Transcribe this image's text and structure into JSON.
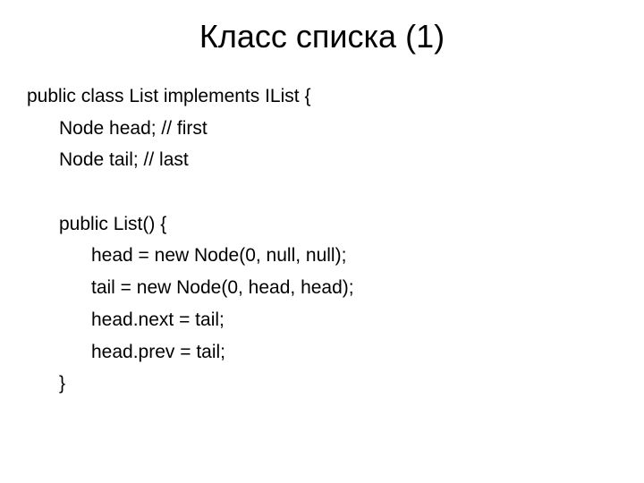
{
  "title": "Класс списка (1)",
  "code": {
    "line0": "public class List implements IList {",
    "line1": "Node head; // first",
    "line2": "Node tail; // last",
    "line3": "",
    "line4": "public List() {",
    "line5": "head = new Node(0, null, null);",
    "line6": "tail = new Node(0, head, head);",
    "line7": "head.next = tail;",
    "line8": "head.prev = tail;",
    "line9": "}"
  }
}
